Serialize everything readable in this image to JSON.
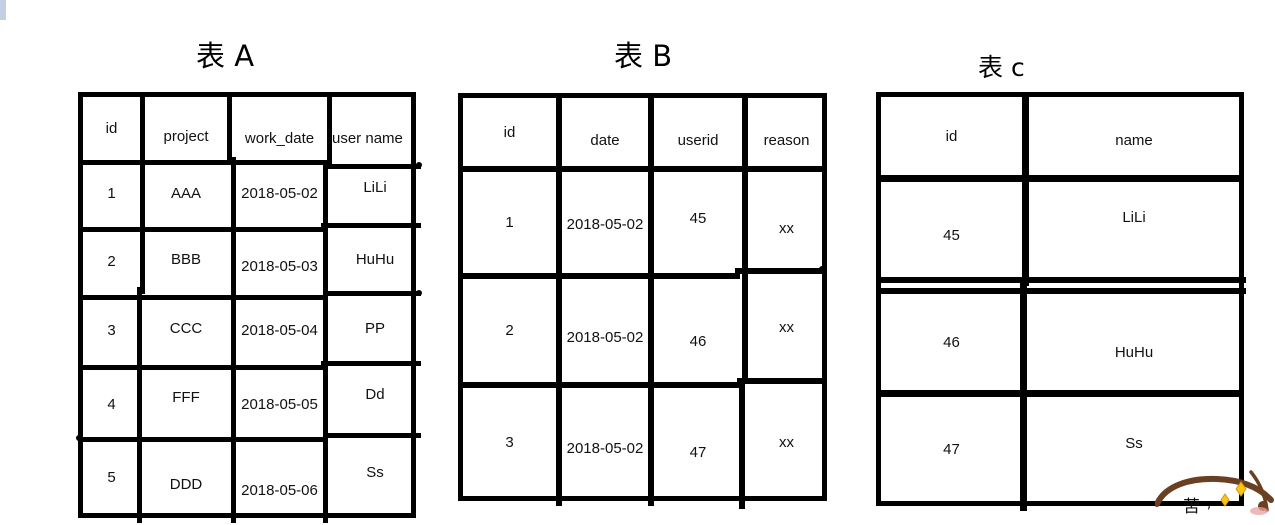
{
  "tables": [
    {
      "id": "a",
      "title": "表 A",
      "columns": [
        "id",
        "project",
        "work_date",
        "user name"
      ],
      "rows": [
        [
          "1",
          "AAA",
          "2018-05-02",
          "LiLi"
        ],
        [
          "2",
          "BBB",
          "2018-05-03",
          "HuHu"
        ],
        [
          "3",
          "CCC",
          "2018-05-04",
          "PP"
        ],
        [
          "4",
          "FFF",
          "2018-05-05",
          "Dd"
        ],
        [
          "5",
          "DDD",
          "2018-05-06",
          "Ss"
        ]
      ]
    },
    {
      "id": "b",
      "title": "表 B",
      "columns": [
        "id",
        "date",
        "userid",
        "reason"
      ],
      "rows": [
        [
          "1",
          "2018-05-02",
          "45",
          "xx"
        ],
        [
          "2",
          "2018-05-02",
          "46",
          "xx"
        ],
        [
          "3",
          "2018-05-02",
          "47",
          "xx"
        ]
      ]
    },
    {
      "id": "c",
      "title": "表 c",
      "columns": [
        "id",
        "name"
      ],
      "rows": [
        [
          "45",
          "LiLi"
        ],
        [
          "46",
          "HuHu"
        ],
        [
          "47",
          "Ss"
        ]
      ]
    }
  ],
  "colors": {
    "ink": "#000000",
    "text": "#111111",
    "top_sliver": "#c3cfe2",
    "watermark_brown": "#6b3f21",
    "watermark_gold": "#f5c518",
    "watermark_pink": "#e8a0a0"
  },
  "watermark": {
    "glyph": "苦"
  }
}
